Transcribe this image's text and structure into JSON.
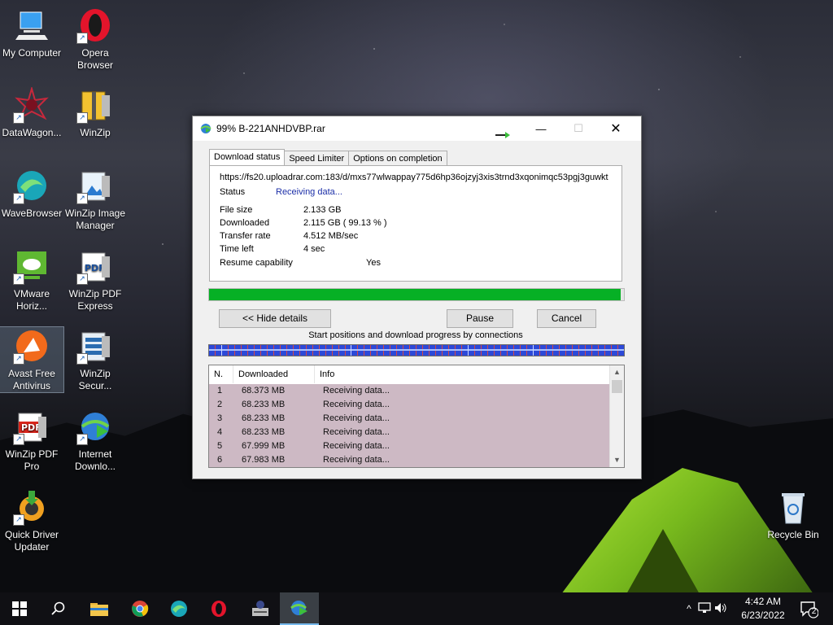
{
  "desktop": {
    "icons": [
      {
        "label": "My Computer"
      },
      {
        "label": "Opera\nBrowser"
      },
      {
        "label": "DataWagon..."
      },
      {
        "label": "WinZip"
      },
      {
        "label": "WaveBrowser"
      },
      {
        "label": "WinZip Image\nManager"
      },
      {
        "label": "VMware\nHoriz..."
      },
      {
        "label": "WinZip PDF\nExpress"
      },
      {
        "label": "Avast Free\nAntivirus"
      },
      {
        "label": "WinZip\nSecur..."
      },
      {
        "label": "WinZip PDF\nPro"
      },
      {
        "label": "Internet\nDownlo..."
      },
      {
        "label": "Quick Driver\nUpdater"
      },
      {
        "label": "Recycle Bin"
      }
    ]
  },
  "dialog": {
    "title": "99% B-221ANHDVBP.rar",
    "tabs": [
      "Download status",
      "Speed Limiter",
      "Options on completion"
    ],
    "url": "https://fs20.uploadrar.com:183/d/mxs77wlwappay775d6hp36ojzyj3xis3trnd3xqonimqc53pgj3guwkt",
    "status_label": "Status",
    "status_value": "Receiving data...",
    "file_size_label": "File size",
    "file_size_value": "2.133  GB",
    "downloaded_label": "Downloaded",
    "downloaded_value": "2.115  GB  ( 99.13 % )",
    "transfer_rate_label": "Transfer rate",
    "transfer_rate_value": "4.512  MB/sec",
    "time_left_label": "Time left",
    "time_left_value": "4 sec",
    "resume_label": "Resume capability",
    "resume_value": "Yes",
    "progress_percent": 99.13,
    "hide_details_label": "<< Hide details",
    "pause_label": "Pause",
    "cancel_label": "Cancel",
    "connections_caption": "Start positions and download progress by connections",
    "table": {
      "headers": [
        "N.",
        "Downloaded",
        "Info"
      ],
      "rows": [
        [
          "1",
          "68.373  MB",
          "Receiving data..."
        ],
        [
          "2",
          "68.233  MB",
          "Receiving data..."
        ],
        [
          "3",
          "68.233  MB",
          "Receiving data..."
        ],
        [
          "4",
          "68.233  MB",
          "Receiving data..."
        ],
        [
          "5",
          "67.999  MB",
          "Receiving data..."
        ],
        [
          "6",
          "67.983  MB",
          "Receiving data..."
        ]
      ]
    }
  },
  "taskbar": {
    "time": "4:42 AM",
    "date": "6/23/2022",
    "notification_count": "2"
  },
  "colors": {
    "progress_fill": "#06b025",
    "status_blue": "#1c2fa8",
    "taskbar_bg": "#101014"
  }
}
